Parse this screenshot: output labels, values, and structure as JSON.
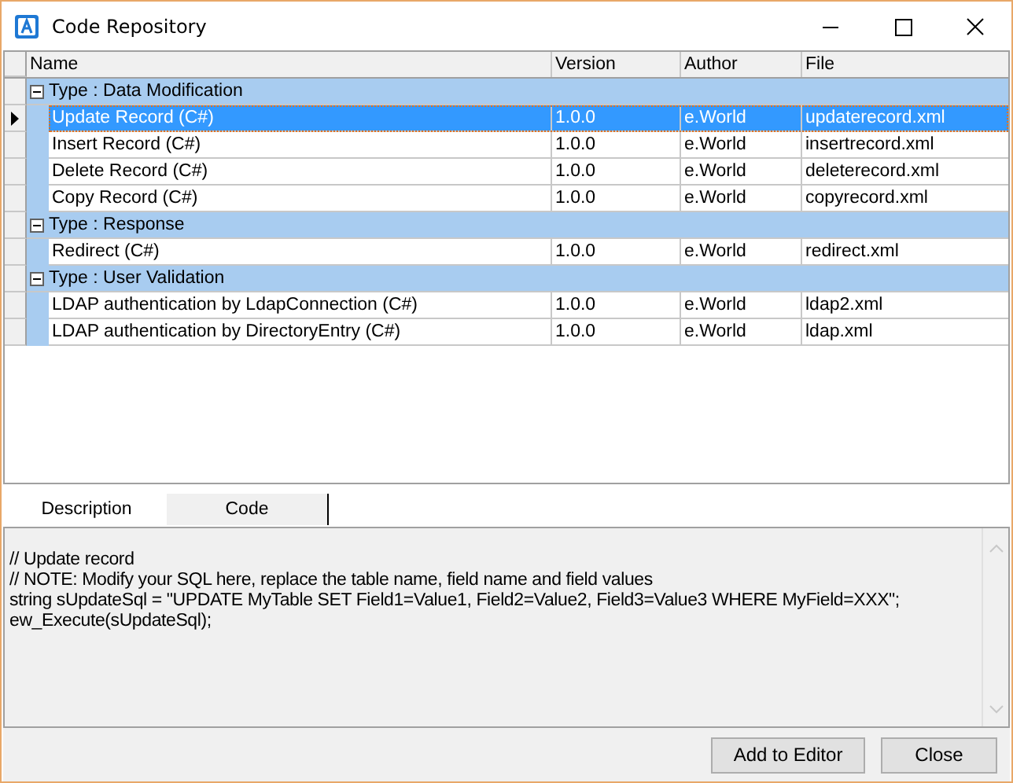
{
  "window": {
    "title": "Code Repository"
  },
  "table": {
    "columns": [
      "Name",
      "Version",
      "Author",
      "File"
    ],
    "groups": [
      {
        "label": "Type : Data Modification",
        "expanded": true,
        "rows": [
          {
            "cells": [
              "Update Record (C#)",
              "1.0.0",
              "e.World",
              "updaterecord.xml"
            ],
            "selected": true
          },
          {
            "cells": [
              "Insert Record (C#)",
              "1.0.0",
              "e.World",
              "insertrecord.xml"
            ],
            "selected": false
          },
          {
            "cells": [
              "Delete Record (C#)",
              "1.0.0",
              "e.World",
              "deleterecord.xml"
            ],
            "selected": false
          },
          {
            "cells": [
              "Copy Record (C#)",
              "1.0.0",
              "e.World",
              "copyrecord.xml"
            ],
            "selected": false
          }
        ]
      },
      {
        "label": "Type : Response",
        "expanded": true,
        "rows": [
          {
            "cells": [
              "Redirect (C#)",
              "1.0.0",
              "e.World",
              "redirect.xml"
            ],
            "selected": false
          }
        ]
      },
      {
        "label": "Type : User Validation",
        "expanded": true,
        "rows": [
          {
            "cells": [
              "LDAP authentication by LdapConnection (C#)",
              "1.0.0",
              "e.World",
              "ldap2.xml"
            ],
            "selected": false
          },
          {
            "cells": [
              "LDAP authentication by DirectoryEntry (C#)",
              "1.0.0",
              "e.World",
              "ldap.xml"
            ],
            "selected": false
          }
        ]
      }
    ]
  },
  "tabs": [
    {
      "label": "Description",
      "selected": false
    },
    {
      "label": "Code",
      "selected": true
    }
  ],
  "code": [
    "// Update record",
    "// NOTE: Modify your SQL here, replace the table name, field name and field values",
    "string sUpdateSql = \"UPDATE MyTable SET Field1=Value1, Field2=Value2, Field3=Value3 WHERE MyField=XXX\";",
    "ew_Execute(sUpdateSql);"
  ],
  "buttons": [
    "Add to Editor",
    "Close"
  ]
}
